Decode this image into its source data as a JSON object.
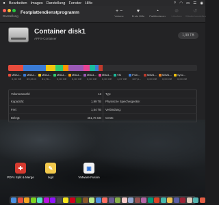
{
  "menubar": {
    "items": [
      "Bearbeiten",
      "Images",
      "Darstellung",
      "Fenster",
      "Hilfe"
    ],
    "status_icons": [
      "search-icon",
      "wifi-icon",
      "battery-icon",
      "control-center-icon",
      "siri-icon"
    ]
  },
  "window": {
    "title": "Festplattendienstprogramm",
    "sidebar_label": "Darstellung",
    "toolbar": [
      {
        "icon": "add-remove-icon",
        "glyph": "+ −",
        "label": "Volume",
        "enabled": true
      },
      {
        "icon": "first-aid-icon",
        "glyph": "♥",
        "label": "Erste Hilfe",
        "enabled": true
      },
      {
        "icon": "partition-icon",
        "glyph": "◔",
        "label": "Partitionieren",
        "enabled": true
      },
      {
        "icon": "erase-icon",
        "glyph": "⊘",
        "label": "Löschen",
        "enabled": false
      },
      {
        "icon": "restore-icon",
        "glyph": "↺",
        "label": "Wiederherstellen",
        "enabled": false
      }
    ]
  },
  "volume": {
    "title": "Container disk1",
    "subtitle": "APFS-Container",
    "size_badge": "1,99 TB"
  },
  "usage_bar": [
    {
      "color": "#e74c3c",
      "fraction": 0.08
    },
    {
      "color": "#3a7bd5",
      "fraction": 0.12
    },
    {
      "color": "#f1c40f",
      "fraction": 0.05
    },
    {
      "color": "#2ecc71",
      "fraction": 0.04
    },
    {
      "color": "#ff9500",
      "fraction": 0.03
    },
    {
      "color": "#9b59b6",
      "fraction": 0.08
    },
    {
      "color": "#e84393",
      "fraction": 0.03
    },
    {
      "color": "#1abc9c",
      "fraction": 0.03
    },
    {
      "color": "#3a7bd5",
      "fraction": 0.02
    },
    {
      "color": "#c0392b",
      "fraction": 0.02
    }
  ],
  "legend": [
    {
      "name": "MBA1...",
      "size": "0,00 GB",
      "color": "#e74c3c"
    },
    {
      "name": "MBA1...",
      "size": "69,35 GB",
      "color": "#3a7bd5"
    },
    {
      "name": "MBA1...",
      "size": "51,76...",
      "color": "#f1c40f"
    },
    {
      "name": "MBA1...",
      "size": "0,00 GB",
      "color": "#2ecc71"
    },
    {
      "name": "MBA1...",
      "size": "0,00 GB",
      "color": "#ff9500"
    },
    {
      "name": "MBA1...",
      "size": "0,00 GB",
      "color": "#9b59b6"
    },
    {
      "name": "MBA1...",
      "size": "0,00 GB",
      "color": "#e84393"
    },
    {
      "name": "VM",
      "size": "1,07 GB",
      "color": "#1abc9c"
    },
    {
      "name": "Prob...",
      "size": "107,6...",
      "color": "#3a7bd5"
    },
    {
      "name": "MBA1...",
      "size": "0,00 GB",
      "color": "#c0392b"
    },
    {
      "name": "MBA1...",
      "size": "0,00 GB",
      "color": "#e67e22"
    },
    {
      "name": "Sync...",
      "size": "0,00 GB",
      "color": "#f1c40f"
    }
  ],
  "info_left": [
    {
      "key": "Volumeanzahl:",
      "value": "13"
    },
    {
      "key": "Kapazität:",
      "value": "1,99 TB"
    },
    {
      "key": "Frei:",
      "value": "1,54 TB"
    },
    {
      "key": "Belegt:",
      "value": "451,76 GB"
    }
  ],
  "info_right": [
    {
      "key": "Typ:",
      "value": ""
    },
    {
      "key": "Physische Speichergeräte:",
      "value": ""
    },
    {
      "key": "Verbindung:",
      "value": ""
    },
    {
      "key": "Gerät:",
      "value": ""
    }
  ],
  "desktop_icons": [
    {
      "label": "PDFs Split & Merge",
      "color": "#d63a2f",
      "glyph": "✚"
    },
    {
      "label": "Ixgit",
      "color": "#f2c94c",
      "glyph": "✎"
    },
    {
      "label": "VMware Fusion",
      "color": "#f2f2f2",
      "glyph": "▣"
    }
  ],
  "dock_colors": [
    "#4a90e2",
    "#e74c3c",
    "#f5a623",
    "#7ed321",
    "#50e3c2",
    "#bd10e0",
    "#9013fe",
    "#4a4a4a",
    "#f8e71c",
    "#d0021b",
    "#417505",
    "#8b572a",
    "#b8e986",
    "#4a90e2",
    "#ff6f61",
    "#6b5b95",
    "#88b04b",
    "#f7cac9",
    "#92a8d1",
    "#955251",
    "#b565a7",
    "#009b77",
    "#dd4124",
    "#45b8ac",
    "#efc050",
    "#5b5ea6",
    "#9b2335",
    "#dfcfbe",
    "#55b4b0",
    "#e15d44"
  ]
}
